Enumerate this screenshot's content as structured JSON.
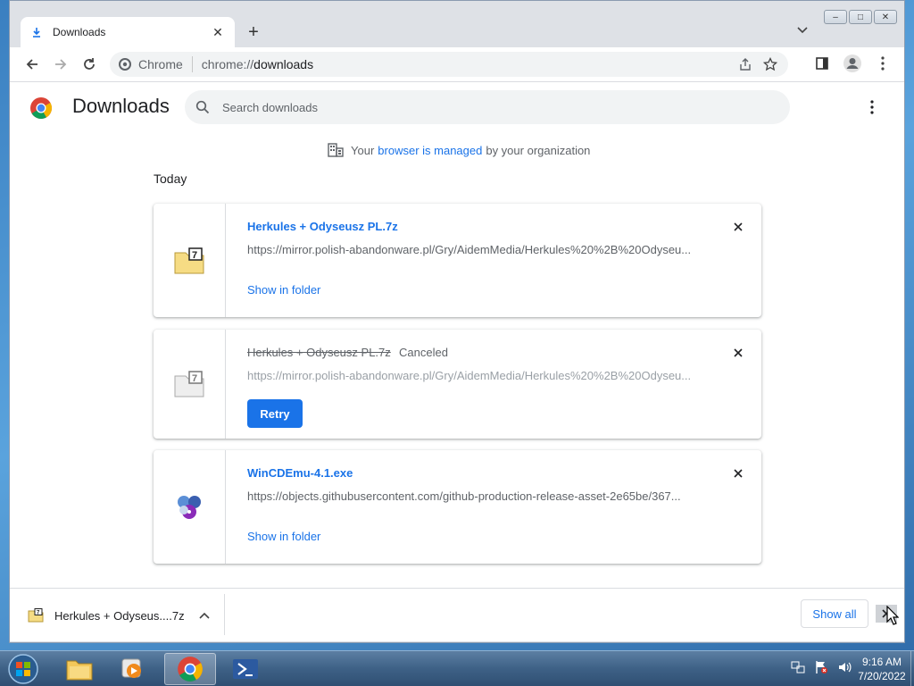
{
  "tab": {
    "title": "Downloads",
    "close": "✕",
    "new_tab": "+"
  },
  "window_controls": {
    "minimize": "‒",
    "maximize": "□",
    "close": "✕"
  },
  "omnibox": {
    "chip_label": "Chrome",
    "url_scheme": "chrome://",
    "url_path": "downloads"
  },
  "page": {
    "title": "Downloads",
    "search_placeholder": "Search downloads",
    "managed": {
      "prefix": "Your",
      "link": "browser is managed",
      "suffix": "by your organization"
    },
    "section_label": "Today"
  },
  "downloads": [
    {
      "file_name": "Herkules + Odyseusz PL.7z",
      "url": "https://mirror.polish-abandonware.pl/Gry/AidemMedia/Herkules%20%2B%20Odyseu...",
      "action": "Show in folder",
      "status": ""
    },
    {
      "file_name": "Herkules + Odyseusz PL.7z",
      "url": "https://mirror.polish-abandonware.pl/Gry/AidemMedia/Herkules%20%2B%20Odyseu...",
      "action": "Retry",
      "status": "Canceled"
    },
    {
      "file_name": "WinCDEmu-4.1.exe",
      "url": "https://objects.githubusercontent.com/github-production-release-asset-2e65be/367...",
      "action": "Show in folder",
      "status": ""
    }
  ],
  "shelf": {
    "item_name": "Herkules + Odyseus....7z",
    "show_all": "Show all"
  },
  "taskbar": {
    "time": "9:16 AM",
    "date": "7/20/2022"
  },
  "colors": {
    "accent": "#1a73e8",
    "text_secondary": "#5f6368",
    "page_bg": "#ffffff",
    "frame": "#dee1e6"
  }
}
